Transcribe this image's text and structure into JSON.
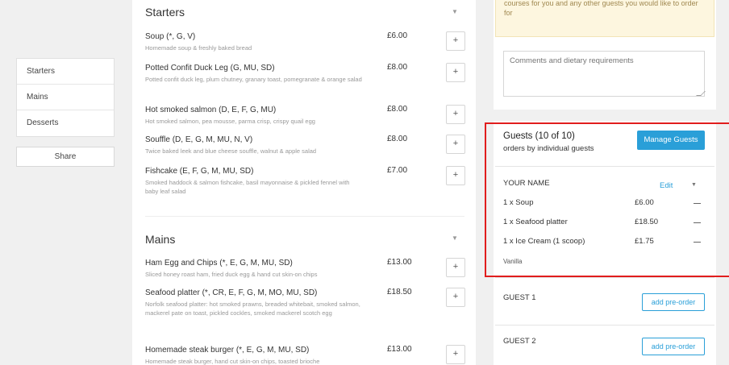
{
  "left_nav": {
    "items": [
      {
        "label": "Starters"
      },
      {
        "label": "Mains"
      },
      {
        "label": "Desserts"
      }
    ],
    "share_label": "Share"
  },
  "menu": {
    "starters": {
      "title": "Starters",
      "items": [
        {
          "name": "Soup (*, G, V)",
          "desc": "Homemade soup & freshly baked bread",
          "price": "£6.00",
          "add": "+"
        },
        {
          "name": "Potted Confit Duck Leg (G, MU, SD)",
          "desc": "Potted confit duck leg, plum chutney, granary toast, pomegranate & orange salad",
          "price": "£8.00",
          "add": "+"
        },
        {
          "name": "Hot smoked salmon (D, E, F, G, MU)",
          "desc": "Hot smoked salmon, pea mousse, parma crisp, crispy quail egg",
          "price": "£8.00",
          "add": "+"
        },
        {
          "name": "Souffle (D, E, G, M, MU, N, V)",
          "desc": "Twice baked leek and blue cheese souffle, walnut & apple salad",
          "price": "£8.00",
          "add": "+"
        },
        {
          "name": "Fishcake (E, F, G, M, MU, SD)",
          "desc": "Smoked haddock & salmon fishcake, basil mayonnaise & pickled fennel with baby leaf salad",
          "price": "£7.00",
          "add": "+"
        }
      ]
    },
    "mains": {
      "title": "Mains",
      "items": [
        {
          "name": "Ham Egg and Chips (*, E, G, M, MU, SD)",
          "desc": "Sliced honey roast ham, fried duck egg & hand cut skin-on chips",
          "price": "£13.00",
          "add": "+"
        },
        {
          "name": "Seafood platter (*, CR, E, F, G, M, MO, MU, SD)",
          "desc": "Norfolk seafood platter: hot smoked prawns, breaded whitebait, smoked salmon, mackerel pate on toast, pickled cockles, smoked mackerel scotch egg",
          "price": "£18.50",
          "add": "+"
        },
        {
          "name": "Homemade steak burger (*, E, G, M, MU, SD)",
          "desc": "Homemade steak burger, hand cut skin-on chips, toasted brioche",
          "price": "£13.00",
          "add": "+"
        }
      ]
    }
  },
  "right": {
    "notice": "courses for you and any other guests you would like to order for",
    "comments_placeholder": "Comments and dietary requirements",
    "guests_title": "Guests (10 of 10)",
    "guests_sub": "orders by individual guests",
    "manage_label": "Manage Guests",
    "your_name": "YOUR NAME",
    "edit_label": "Edit",
    "orders": [
      {
        "item": "1 x Soup",
        "price": "£6.00"
      },
      {
        "item": "1 x Seafood platter",
        "price": "£18.50"
      },
      {
        "item": "1 x Ice Cream (1 scoop)",
        "price": "£1.75"
      }
    ],
    "order_note": "Vanilla",
    "guests": [
      {
        "label": "GUEST 1",
        "button": "add pre-order"
      },
      {
        "label": "GUEST 2",
        "button": "add pre-order"
      }
    ]
  },
  "colors": {
    "accent": "#2a9fd8",
    "highlight": "#e11d1d",
    "notice_bg": "#fdf6df"
  }
}
